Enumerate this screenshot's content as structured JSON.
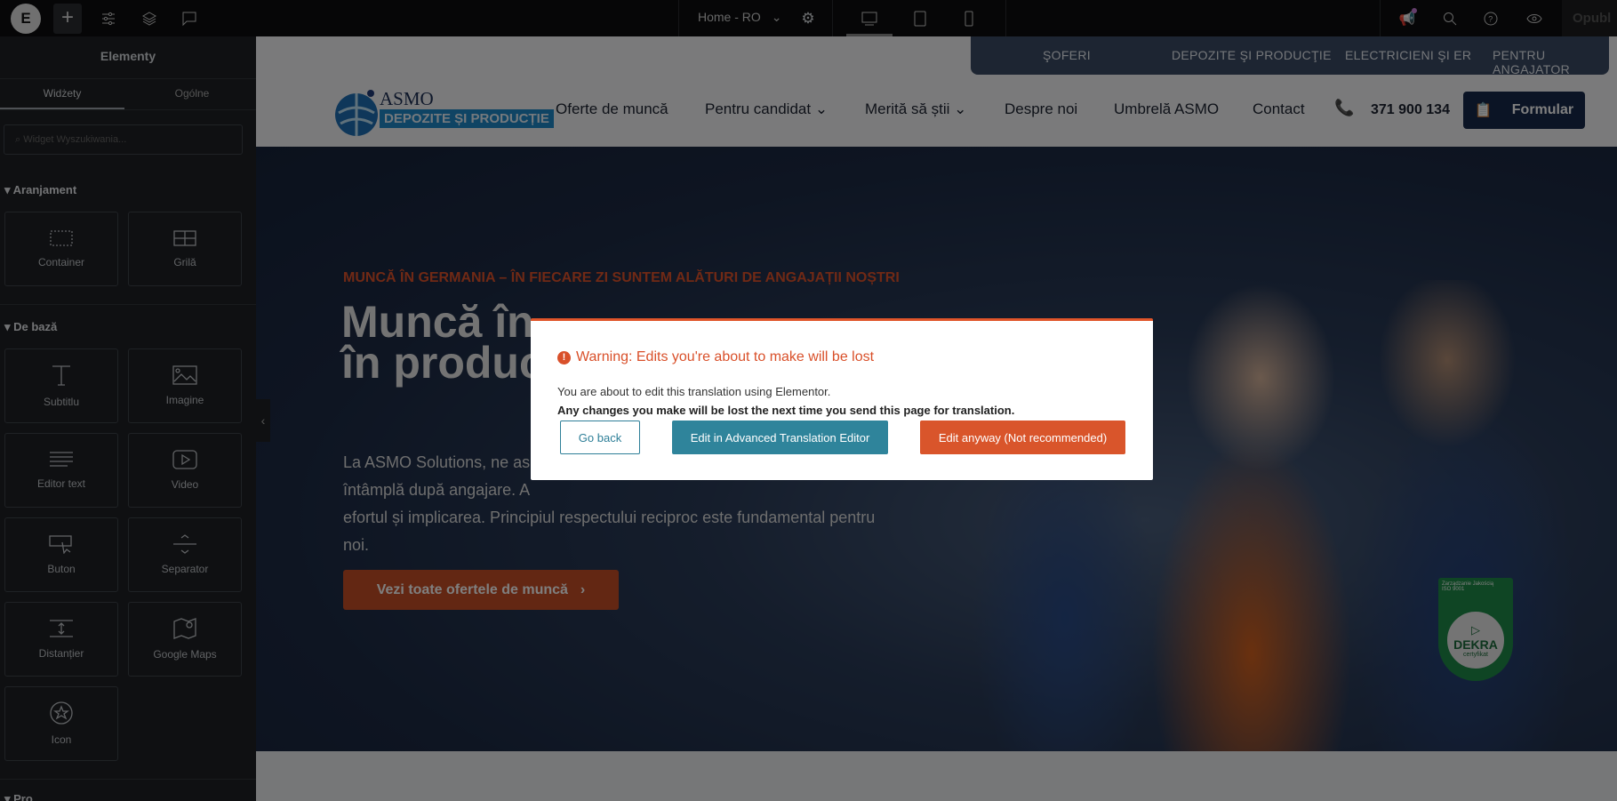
{
  "topbar": {
    "page_select": "Home - RO",
    "publish_label": "Opubl",
    "colors": {
      "notification_dot": "#c77dd6"
    }
  },
  "sidebar": {
    "title": "Elementy",
    "tabs": [
      "Widżety",
      "Ogólne"
    ],
    "search_placeholder": "Widget Wyszukiwania...",
    "sections": [
      {
        "title": "Aranjament",
        "widgets": [
          "Container",
          "Grilă"
        ]
      },
      {
        "title": "De bază",
        "widgets": [
          "Subtitlu",
          "Imagine",
          "Editor text",
          "Video",
          "Buton",
          "Separator",
          "Distanțier",
          "Google Maps",
          "Icon"
        ]
      },
      {
        "title": "Pro"
      }
    ]
  },
  "site": {
    "top_nav": [
      "ŞOFERI",
      "DEPOZITE ŞI PRODUCŢIE",
      "ELECTRICIENI ŞI ER",
      "PENTRU ANGAJATOR"
    ],
    "logo": {
      "name": "ASMO",
      "tagline": "DEPOZITE ȘI PRODUCȚIE"
    },
    "main_nav": [
      "Oferte de muncă",
      "Pentru candidat",
      "Merită să știi",
      "Despre noi",
      "Umbrelă ASMO",
      "Contact"
    ],
    "phone": "371 900 134",
    "form_button": "Formular",
    "hero": {
      "kicker": "MUNCĂ ÎN GERMANIA – ÎN FIECARE ZI SUNTEM ALĂTURI DE ANGAJAȚII NOȘTRI",
      "headline_1": "Muncă în",
      "headline_2": "în produc",
      "para": [
        "La ASMO Solutions, ne as",
        "întâmplă după angajare. A",
        "efortul și implicarea. Principiul respectului reciproc este fundamental pentru",
        "noi."
      ],
      "cta": "Vezi toate ofertele de muncă",
      "badge": {
        "line1": "Zarządzanie Jakością",
        "line2": "ISO 9001",
        "brand": "DEKRA",
        "cert": "certyfikat"
      }
    }
  },
  "dialog": {
    "title": "Warning: Edits you're about to make will be lost",
    "line1": "You are about to edit this translation using Elementor.",
    "line2": "Any changes you make will be lost the next time you send this page for translation.",
    "go_back": "Go back",
    "advanced": "Edit in Advanced Translation Editor",
    "edit_anyway": "Edit anyway (Not recommended)"
  }
}
